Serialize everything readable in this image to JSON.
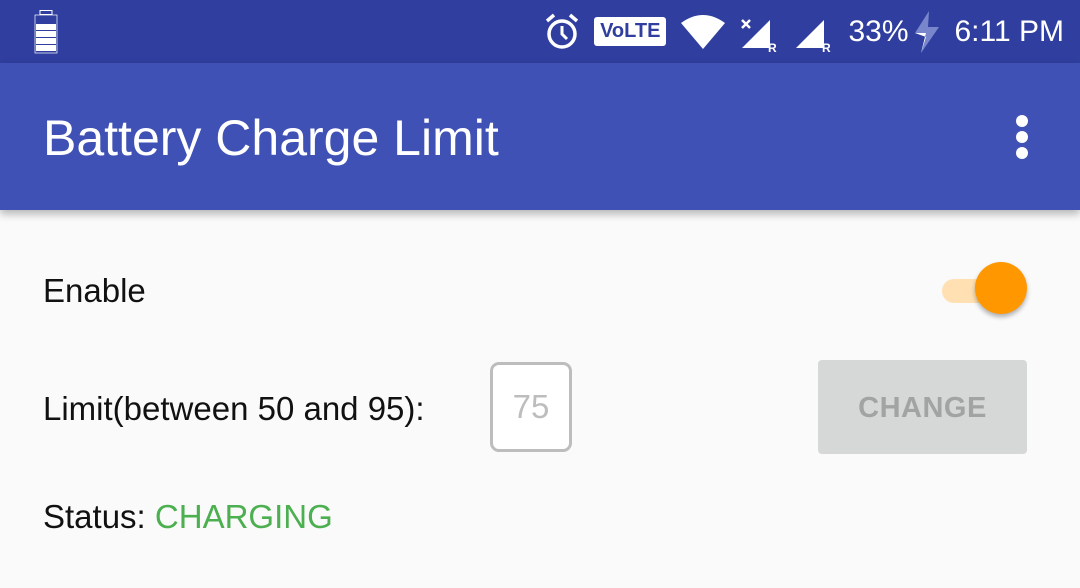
{
  "status_bar": {
    "battery_percent": "33%",
    "time": "6:11 PM",
    "volte_label": "VoLTE",
    "icons": [
      "battery-icon",
      "alarm-icon",
      "volte-icon",
      "wifi-icon",
      "signal-no-sim-roaming-icon",
      "signal-roaming-icon",
      "charging-bolt-icon"
    ]
  },
  "app_bar": {
    "title": "Battery Charge Limit",
    "menu_icon": "more-vert-icon"
  },
  "settings": {
    "enable_label": "Enable",
    "enable_on": true,
    "limit_label": "Limit(between 50 and 95):",
    "limit_value": "75",
    "change_button": "CHANGE",
    "status_label": "Status:",
    "status_value": "CHARGING"
  },
  "colors": {
    "status_bar": "#303f9f",
    "app_bar": "#3f51b5",
    "accent": "#ff9800",
    "status_charging": "#4caf50"
  }
}
